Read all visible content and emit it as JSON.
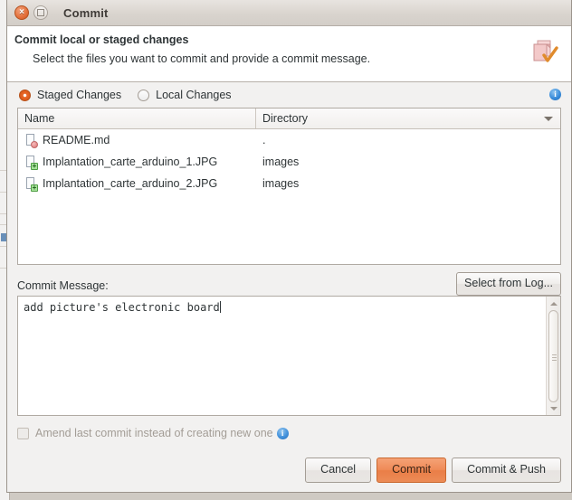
{
  "window": {
    "title": "Commit",
    "close_label": "×",
    "maximize_label": ""
  },
  "banner": {
    "title": "Commit local or staged changes",
    "subtitle": "Select the files you want to commit and provide a commit message.",
    "icon": "commit-check-icon"
  },
  "scope": {
    "staged_label": "Staged Changes",
    "local_label": "Local Changes",
    "selected": "Staged Changes",
    "info_label": "i"
  },
  "table": {
    "columns": [
      "Name",
      "Directory"
    ],
    "sort_indicator": "descending",
    "rows": [
      {
        "icon": "file-modified-icon",
        "name": "README.md",
        "directory": "."
      },
      {
        "icon": "file-added-icon",
        "name": "Implantation_carte_arduino_1.JPG",
        "directory": "images"
      },
      {
        "icon": "file-added-icon",
        "name": "Implantation_carte_arduino_2.JPG",
        "directory": "images"
      }
    ]
  },
  "message": {
    "label": "Commit Message:",
    "select_from_log_label": "Select from Log...",
    "value": "add picture's electronic board",
    "placeholder": ""
  },
  "amend": {
    "label": "Amend last commit instead of creating new one",
    "checked": false,
    "enabled": false,
    "info_label": "i"
  },
  "footer": {
    "cancel_label": "Cancel",
    "commit_label": "Commit",
    "commit_push_label": "Commit & Push"
  },
  "colors": {
    "accent": "#ea7e47",
    "titlebar": "#d9d4ce",
    "panel": "#f2f1f0",
    "text": "#2e3436",
    "info_blue": "#3a8ddb",
    "added_green": "#4f9d44",
    "modified_red": "#cf6f6f"
  }
}
